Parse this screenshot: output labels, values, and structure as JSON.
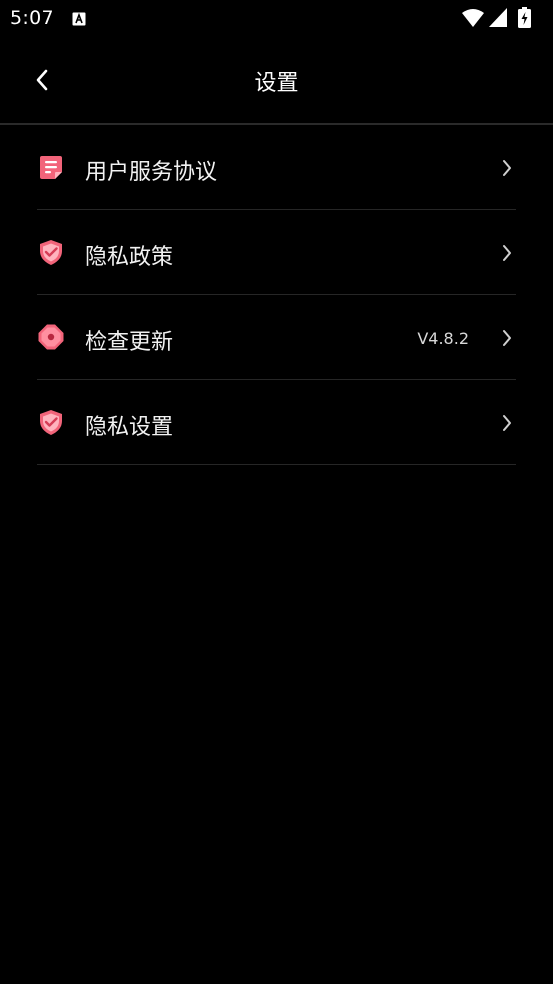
{
  "status_bar": {
    "time": "5:07",
    "notification_icon": "a-icon",
    "wifi_icon": "wifi-icon",
    "signal_icon": "signal-icon",
    "battery_icon": "battery-charging-icon"
  },
  "header": {
    "back_icon": "chevron-left-icon",
    "title": "设置"
  },
  "colors": {
    "background": "#000000",
    "accent": "#f2647a",
    "divider": "#262626",
    "text": "#f2f2f2"
  },
  "settings": {
    "items": [
      {
        "label": "用户服务协议",
        "icon": "document-icon",
        "value": ""
      },
      {
        "label": "隐私政策",
        "icon": "shield-check-icon",
        "value": ""
      },
      {
        "label": "检查更新",
        "icon": "update-badge-icon",
        "value": "V4.8.2"
      },
      {
        "label": "隐私设置",
        "icon": "shield-check-icon",
        "value": ""
      }
    ]
  }
}
